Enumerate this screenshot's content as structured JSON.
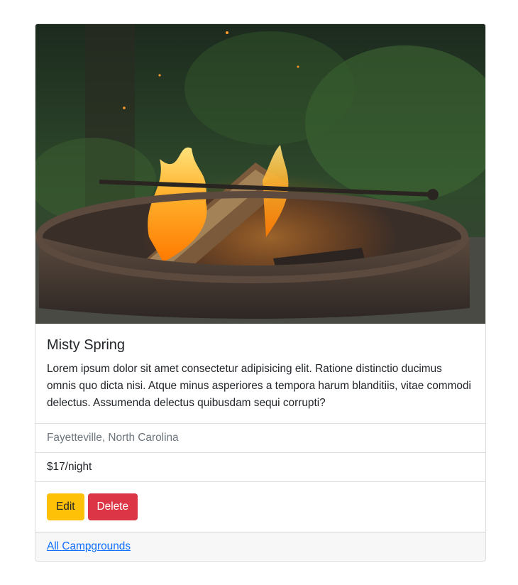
{
  "campground": {
    "title": "Misty Spring",
    "description": "Lorem ipsum dolor sit amet consectetur adipisicing elit. Ratione distinctio ducimus omnis quo dicta nisi. Atque minus asperiores a tempora harum blanditiis, vitae commodi delectus. Assumenda delectus quibusdam sequi corrupti?",
    "location": "Fayetteville, North Carolina",
    "price": "$17/night"
  },
  "actions": {
    "edit_label": "Edit",
    "delete_label": "Delete"
  },
  "footer": {
    "link_label": "All Campgrounds"
  },
  "colors": {
    "warning": "#ffc107",
    "danger": "#dc3545",
    "link": "#0d6efd"
  }
}
